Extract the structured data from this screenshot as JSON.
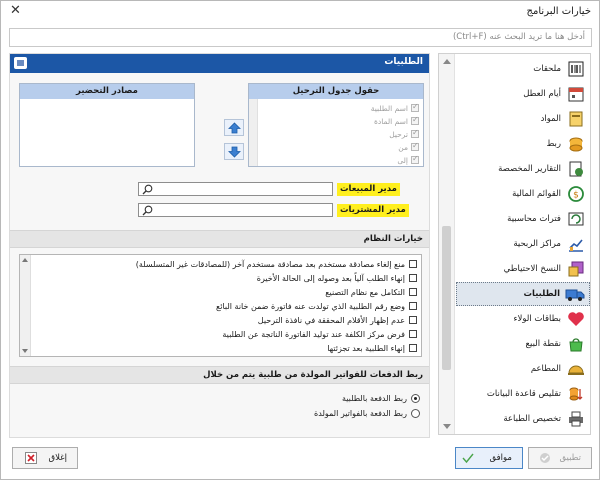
{
  "window": {
    "title": "خيارات البرنامج",
    "close_glyph": "✕"
  },
  "search": {
    "placeholder": "أدخل هنا ما تريد البحث عنه (Ctrl+F)"
  },
  "section": {
    "title": "الطلبيات"
  },
  "migration_fields": {
    "title": "حقول جدول الترحيل",
    "items": [
      {
        "label": "اسم الطلبية",
        "checked": true
      },
      {
        "label": "اسم المادة",
        "checked": true
      },
      {
        "label": "ترحيل",
        "checked": true
      },
      {
        "label": "من",
        "checked": true
      },
      {
        "label": "إلى",
        "checked": true
      }
    ]
  },
  "prep_sources": {
    "title": "مصادر التحضير"
  },
  "managers": {
    "sales_label": "مدير المبيعات",
    "purchases_label": "مدير المشتريات"
  },
  "system_options": {
    "title": "خيارات النظام",
    "items": [
      "منع إلغاء مصادقة مستخدم بعد مصادقة مستخدم آخر (للمصادقات غير المتسلسلة)",
      "إنهاء الطلب آلياً بعد وصوله إلى الحالة الأخيرة",
      "التكامل مع نظام التصنيع",
      "وضع رقم الطلبية الذي تولدت عنه فاتورة ضمن خانة البائع",
      "عدم إظهار الأقلام المحققة في نافذة الترحيل",
      "فرض مركز الكلفة عند توليد الفاتورة الناتجة عن الطلبية",
      "إنهاء الطلبية بعد تجزئتها"
    ]
  },
  "payment_link": {
    "title": "ربط الدفعات للفواتير المولدة من طلبية يتم من خلال",
    "options": [
      {
        "label": "ربط الدفعة بالطلبية",
        "selected": true
      },
      {
        "label": "ربط الدفعة بالفواتير المولدة",
        "selected": false
      }
    ]
  },
  "nav": {
    "items": [
      {
        "label": "ملحقات",
        "icon": "attachments-icon",
        "selected": false
      },
      {
        "label": "أيام العطل",
        "icon": "calendar-icon",
        "selected": false
      },
      {
        "label": "المواد",
        "icon": "materials-icon",
        "selected": false
      },
      {
        "label": "ربط",
        "icon": "link-icon",
        "selected": false
      },
      {
        "label": "التقارير المخصصة",
        "icon": "reports-icon",
        "selected": false
      },
      {
        "label": "القوائم المالية",
        "icon": "financial-lists-icon",
        "selected": false
      },
      {
        "label": "فترات محاسبية",
        "icon": "accounting-periods-icon",
        "selected": false
      },
      {
        "label": "مراكز الربحية",
        "icon": "profit-centers-icon",
        "selected": false
      },
      {
        "label": "النسخ الاحتياطي",
        "icon": "backup-icon",
        "selected": false
      },
      {
        "label": "الطلبيات",
        "icon": "orders-truck-icon",
        "selected": true
      },
      {
        "label": "بطاقات الولاء",
        "icon": "loyalty-heart-icon",
        "selected": false
      },
      {
        "label": "نقطة البيع",
        "icon": "pos-bag-icon",
        "selected": false
      },
      {
        "label": "المطاعم",
        "icon": "restaurant-dish-icon",
        "selected": false
      },
      {
        "label": "تقليص قاعدة البيانات",
        "icon": "shrink-db-icon",
        "selected": false
      },
      {
        "label": "تخصيص الطباعة",
        "icon": "printer-icon",
        "selected": false
      }
    ]
  },
  "footer": {
    "apply": "تطبيق",
    "ok": "موافق",
    "close": "إغلاق"
  },
  "colors": {
    "header_blue": "#1c57a6",
    "highlight_yellow": "#ffef1e",
    "panel_head": "#b7cdec"
  }
}
